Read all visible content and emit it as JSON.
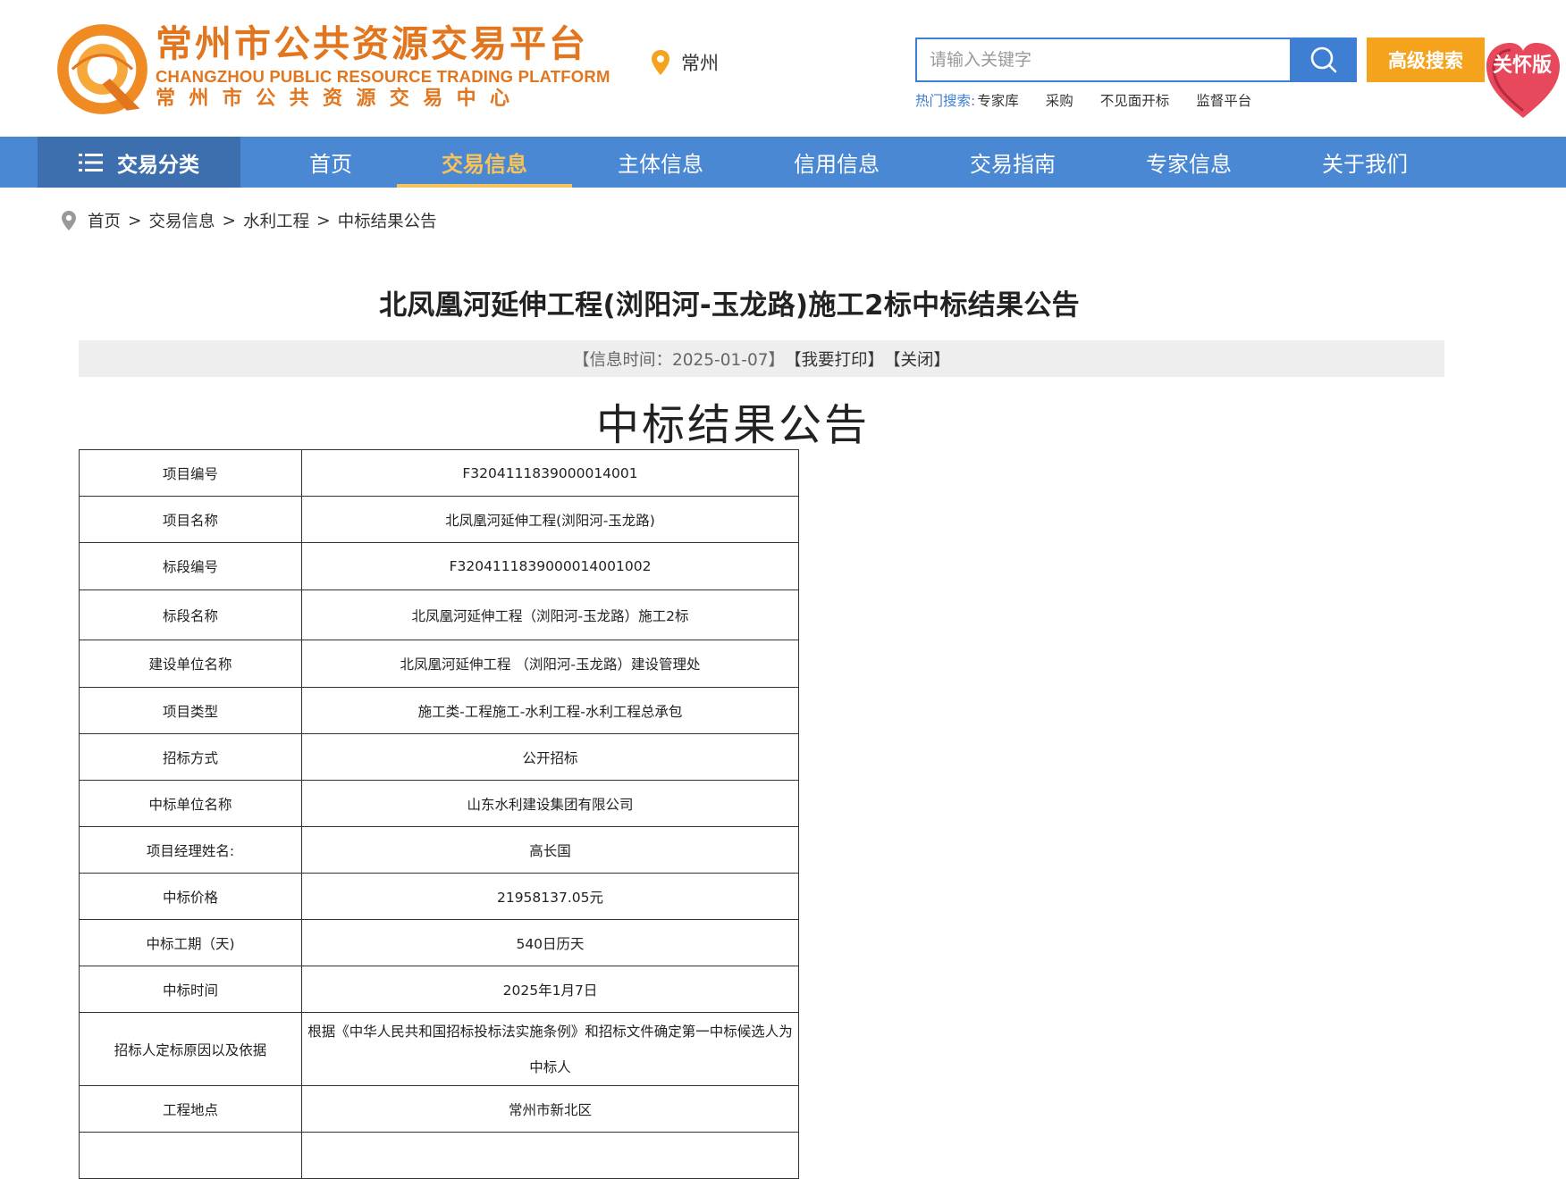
{
  "header": {
    "logo_cn": "常州市公共资源交易平台",
    "logo_en": "CHANGZHOU PUBLIC RESOURCE TRADING PLATFORM",
    "logo_cn2": "常州市公共资源交易中心",
    "location": "常州",
    "search_placeholder": "请输入关键字",
    "advanced_search": "高级搜索",
    "care_label": "关怀版",
    "hot_label": "热门搜索:",
    "hot_items": [
      "专家库",
      "采购",
      "不见面开标",
      "监督平台"
    ]
  },
  "nav": {
    "category": "交易分类",
    "items": [
      "首页",
      "交易信息",
      "主体信息",
      "信用信息",
      "交易指南",
      "专家信息",
      "关于我们"
    ],
    "active": "交易信息"
  },
  "breadcrumb": [
    "首页",
    "交易信息",
    "水利工程",
    "中标结果公告"
  ],
  "article": {
    "title": "北凤凰河延伸工程(浏阳河-玉龙路)施工2标中标结果公告",
    "info_time": "【信息时间：2025-01-07】",
    "print": "【我要打印】",
    "close": "【关闭】",
    "doc_title": "中标结果公告"
  },
  "table": [
    {
      "k": "项目编号",
      "v": "F3204111839000014001"
    },
    {
      "k": "项目名称",
      "v": "北凤凰河延伸工程(浏阳河-玉龙路)"
    },
    {
      "k": "标段编号",
      "v": "F3204111839000014001002"
    },
    {
      "k": "标段名称",
      "v": "北凤凰河延伸工程（浏阳河-玉龙路）施工2标"
    },
    {
      "k": "建设单位名称",
      "v": "北凤凰河延伸工程 （浏阳河-玉龙路）建设管理处"
    },
    {
      "k": "项目类型",
      "v": "施工类-工程施工-水利工程-水利工程总承包"
    },
    {
      "k": "招标方式",
      "v": "公开招标"
    },
    {
      "k": "中标单位名称",
      "v": "山东水利建设集团有限公司"
    },
    {
      "k": "项目经理姓名:",
      "v": "高长国"
    },
    {
      "k": "中标价格",
      "v": "21958137.05元"
    },
    {
      "k": "中标工期（天)",
      "v": "540日历天"
    },
    {
      "k": "中标时间",
      "v": "2025年1月7日"
    },
    {
      "k": "招标人定标原因以及依据",
      "v": "根据《中华人民共和国招标投标法实施条例》和招标文件确定第一中标候选人为中标人"
    },
    {
      "k": "工程地点",
      "v": "常州市新北区"
    }
  ],
  "colors": {
    "brand_orange": "#e2761f",
    "nav_blue": "#4a88d3",
    "nav_dark": "#3d6fae",
    "search_blue": "#3e7fd3",
    "accent_yellow": "#f7c35a",
    "advanced_orange": "#f5a21c"
  },
  "icons": [
    "logo-icon",
    "location-pin-icon",
    "search-icon",
    "care-heart-icon",
    "menu-icon",
    "breadcrumb-pin-icon"
  ]
}
